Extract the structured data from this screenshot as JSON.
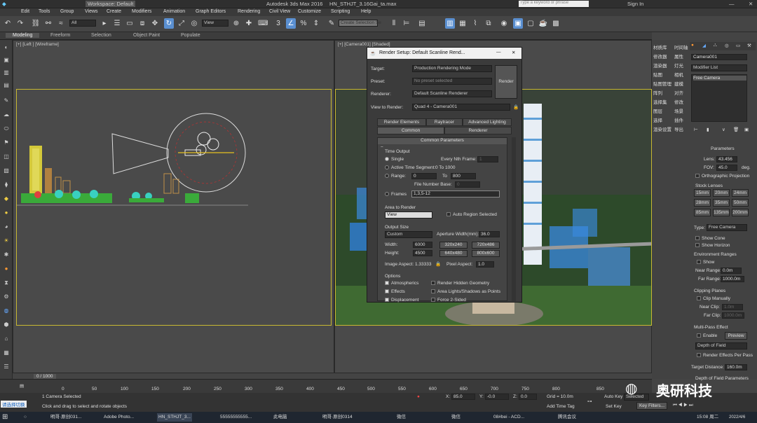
{
  "window": {
    "app_title": "Autodesk 3ds Max 2016",
    "file_title": "HN_STHJT_3.16Gai_ta.max",
    "workspace": "Workspace: Default",
    "search_placeholder": "Type a keyword or phrase",
    "sign_in": "Sign In"
  },
  "menu": [
    "Edit",
    "Tools",
    "Group",
    "Views",
    "Create",
    "Modifiers",
    "Animation",
    "Graph Editors",
    "Rendering",
    "Civil View",
    "Customize",
    "Scripting",
    "Help"
  ],
  "toolbar": {
    "selection_filter": "All",
    "ref_coord": "View",
    "named_selection": "Create Selection Se"
  },
  "ribbon": [
    "Modeling",
    "Freeform",
    "Selection",
    "Object Paint",
    "Populate"
  ],
  "viewports": {
    "left_label": "[+] [Left ] [Wireframe]",
    "camera_label": "[+] [Camera001] [Shaded]"
  },
  "render_setup": {
    "title": "Render Setup: Default Scanline Rend...",
    "target_label": "Target:",
    "target_value": "Production Rendering Mode",
    "preset_label": "Preset:",
    "preset_value": "No preset selected",
    "renderer_label": "Renderer:",
    "renderer_value": "Default Scanline Renderer",
    "view_label": "View to Render:",
    "view_value": "Quad 4 - Camera001",
    "render_button": "Render",
    "tabs_top": [
      "Render Elements",
      "Raytracer",
      "Advanced Lighting"
    ],
    "tabs_bottom": [
      "Common",
      "Renderer"
    ],
    "rollout": "Common Parameters",
    "time_output": "Time Output",
    "single": "Single",
    "every_nth": "Every Nth Frame:",
    "every_nth_value": "1",
    "active_segment": "Active Time Segment:",
    "active_segment_range": "0 To 1000",
    "range": "Range:",
    "range_from": "0",
    "range_to_label": "To",
    "range_to": "800",
    "file_number_base": "File Number Base:",
    "file_number_value": "0",
    "frames": "Frames",
    "frames_value": "1,3,5-12",
    "area_to_render": "Area to Render",
    "area_value": "View",
    "auto_region": "Auto Region Selected",
    "output_size": "Output Size",
    "size_preset": "Custom",
    "aperture_label": "Aperture Width(mm):",
    "aperture_value": "36.0",
    "width_label": "Width:",
    "width_value": "6000",
    "height_label": "Height:",
    "height_value": "4500",
    "presets": [
      "320x240",
      "720x486",
      "640x480",
      "800x600"
    ],
    "image_aspect": "Image Aspect: 1.33333",
    "pixel_aspect_label": "Pixel Aspect:",
    "pixel_aspect_value": "1.0",
    "options": "Options",
    "opt_left": [
      "Atmospherics",
      "Effects",
      "Displacement"
    ],
    "opt_right": [
      "Render Hidden Geometry",
      "Area Lights/Shadows as Points",
      "Force 2-Sided"
    ]
  },
  "cmd_panel": {
    "object_name": "Camera001",
    "modifier_list": "Modifier List",
    "stack_item": "Free Camera",
    "parameters": "Parameters",
    "lens_label": "Lens:",
    "lens_value": "43.456",
    "fov_label": "FOV:",
    "fov_value": "45.0",
    "fov_unit": "deg.",
    "ortho": "Orthographic Projection",
    "stock_lenses": "Stock Lenses",
    "lenses": [
      "15mm",
      "20mm",
      "24mm",
      "28mm",
      "35mm",
      "50mm",
      "85mm",
      "135mm",
      "200mm"
    ],
    "type_label": "Type:",
    "type_value": "Free Camera",
    "show_cone": "Show Cone",
    "show_horizon": "Show Horizon",
    "env_ranges": "Environment Ranges",
    "env_show": "Show",
    "near_range_label": "Near Range:",
    "near_range": "0.0m",
    "far_range_label": "Far Range:",
    "far_range": "1000.0m",
    "clipping": "Clipping Planes",
    "clip_manually": "Clip Manually",
    "near_clip_label": "Near Clip:",
    "near_clip": "1.0m",
    "far_clip_label": "Far Clip:",
    "far_clip": "1000.0m",
    "multipass": "Multi-Pass Effect",
    "mp_enable": "Enable",
    "mp_preview": "Preview",
    "mp_effect": "Depth of Field",
    "mp_per_pass": "Render Effects Per Pass",
    "target_distance_label": "Target Distance:",
    "target_distance": "160.0m",
    "dof_params": "Depth of Field Parameters"
  },
  "plugins_col": [
    "材质库",
    "时间轴",
    "修改器",
    "属性",
    "渲染器",
    "灯光",
    "贴图",
    "相机",
    "贴图管理",
    "建模",
    "阵列",
    "对齐",
    "选择集",
    "修改",
    "图层",
    "场景",
    "选择",
    "插件",
    "渲染设置",
    "导出"
  ],
  "timeline": {
    "frame": "0 / 1000",
    "ticks": [
      "0",
      "50",
      "100",
      "150",
      "200",
      "250",
      "300",
      "350",
      "400",
      "450",
      "500",
      "550",
      "600",
      "650",
      "700",
      "750",
      "800",
      "850"
    ]
  },
  "status": {
    "selected": "1 Camera Selected",
    "hint": "Click and drag to select and rotate objects",
    "x_label": "X:",
    "x": "85.0",
    "y_label": "Y:",
    "y": "-0.0",
    "z_label": "Z:",
    "z": "0.0",
    "grid": "Grid = 10.0m",
    "auto_key": "Auto Key",
    "set_key": "Set Key",
    "selected_mode": "Selected",
    "key_filters": "Key Filters...",
    "add_time_tag": "Add Time Tag",
    "left_badge": "请选择切换"
  },
  "watermark": "奥研科技",
  "taskbar": {
    "items": [
      "明哥·原创031...",
      "Adobe Photo...",
      "HN_STHJT_3...",
      "55555555555...",
      "此电脑",
      "明哥·原创0314",
      "微信",
      "微信",
      "08#bei - ACD...",
      "腾讯会议"
    ],
    "time": "15:08 周二",
    "date": "2022/4/6"
  },
  "colors": {
    "accent": "#5a8fd0",
    "viewport": "#4a4a4a",
    "frame": "#c8b832",
    "dialog": "#3b3b3b"
  }
}
